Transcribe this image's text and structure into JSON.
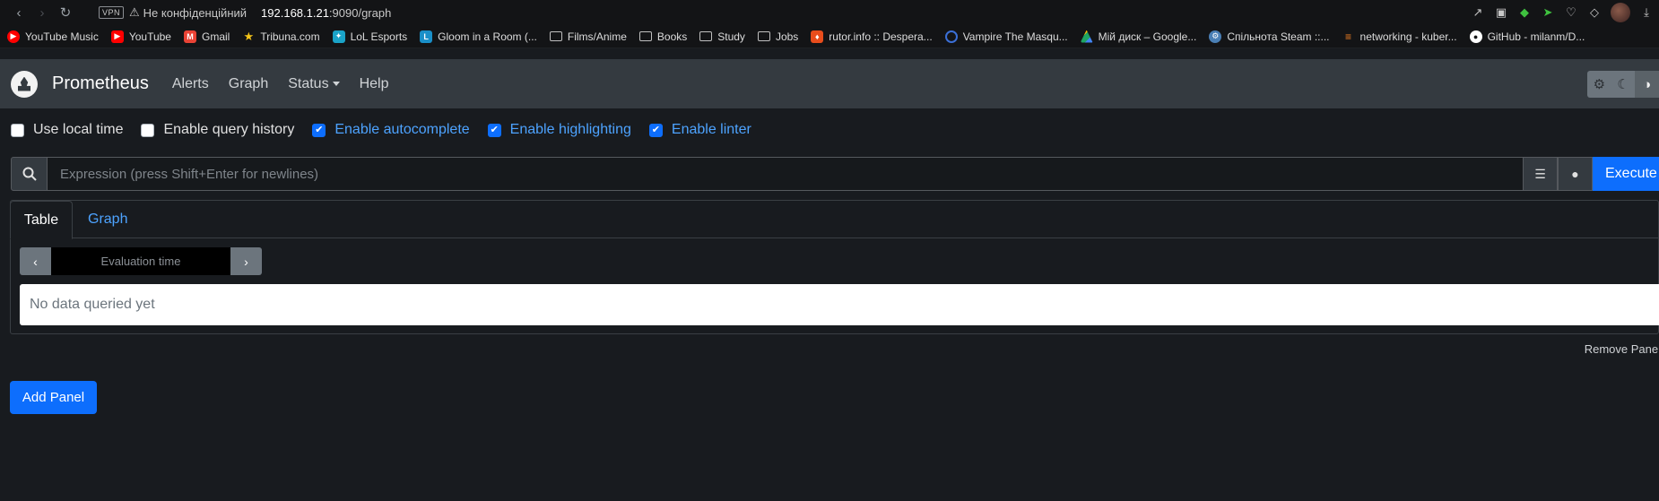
{
  "browser": {
    "vpn": "VPN",
    "not_secure": "Не конфіденційний",
    "url_host": "192.168.1.21",
    "url_rest": ":9090/graph"
  },
  "bookmarks": [
    {
      "label": "YouTube Music",
      "icon": "youtube-music-icon",
      "color": "#ff0000"
    },
    {
      "label": "YouTube",
      "icon": "youtube-icon",
      "color": "#ff0000"
    },
    {
      "label": "Gmail",
      "icon": "gmail-icon",
      "color": "#ea4335"
    },
    {
      "label": "Tribuna.com",
      "icon": "star-icon",
      "color": "#f5c518"
    },
    {
      "label": "LoL Esports",
      "icon": "lol-esports-icon",
      "color": "#1aa3c8"
    },
    {
      "label": "Gloom in a Room (...",
      "icon": "l-icon",
      "color": "#1a8fc8"
    },
    {
      "label": "Films/Anime",
      "icon": "folder-icon",
      "color": ""
    },
    {
      "label": "Books",
      "icon": "folder-icon",
      "color": ""
    },
    {
      "label": "Study",
      "icon": "folder-icon",
      "color": ""
    },
    {
      "label": "Jobs",
      "icon": "folder-icon",
      "color": ""
    },
    {
      "label": "rutor.info :: Despera...",
      "icon": "rutor-icon",
      "color": "#e84d1c"
    },
    {
      "label": "Vampire The Masqu...",
      "icon": "search-circle-icon",
      "color": "#3b6fd6"
    },
    {
      "label": "Мій диск – Google...",
      "icon": "google-drive-icon",
      "color": "#1fa463"
    },
    {
      "label": "Спільнота Steam ::...",
      "icon": "steam-icon",
      "color": "#4a7fb5"
    },
    {
      "label": "networking - kuber...",
      "icon": "stackoverflow-icon",
      "color": "#f48024"
    },
    {
      "label": "GitHub - milanm/D...",
      "icon": "github-icon",
      "color": "#ffffff"
    }
  ],
  "navbar": {
    "brand": "Prometheus",
    "links": [
      "Alerts",
      "Graph",
      "Status",
      "Help"
    ]
  },
  "options": [
    {
      "label": "Use local time",
      "checked": false
    },
    {
      "label": "Enable query history",
      "checked": false
    },
    {
      "label": "Enable autocomplete",
      "checked": true
    },
    {
      "label": "Enable highlighting",
      "checked": true
    },
    {
      "label": "Enable linter",
      "checked": true
    }
  ],
  "expression": {
    "placeholder": "Expression (press Shift+Enter for newlines)",
    "execute_label": "Execute"
  },
  "panel": {
    "tabs": [
      "Table",
      "Graph"
    ],
    "eval_placeholder": "Evaluation time",
    "no_data": "No data queried yet",
    "remove_label": "Remove Panel"
  },
  "add_panel_label": "Add Panel",
  "colors": {
    "accent": "#0d6efd",
    "navbar": "#343a40",
    "background": "#181b1f"
  }
}
